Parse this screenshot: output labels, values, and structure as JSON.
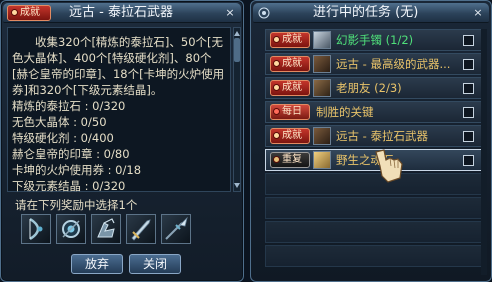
{
  "quest_detail": {
    "category_tag": "成就",
    "title": "远古 - 泰拉石武器",
    "close_glyph": "×",
    "description": "收集320个[精炼的泰拉石]、50个[无色大晶体]、400个[特级硬化剂]、80个[赫仑皇帝的印章]、18个[卡坤的火炉使用券]和320个[下级元素结晶]。",
    "requirements": [
      "精炼的泰拉石 : 0/320",
      "无色大晶体 : 0/50",
      "特级硬化剂 : 0/400",
      "赫仑皇帝的印章 : 0/80",
      "卡坤的火炉使用券 : 0/18",
      "下级元素结晶 : 0/320"
    ],
    "reward_prompt": "请在下列奖励中选择1个",
    "rewards": [
      {
        "icon": "bow-icon"
      },
      {
        "icon": "orb-staff-icon"
      },
      {
        "icon": "gauntlet-icon"
      },
      {
        "icon": "sword-icon"
      },
      {
        "icon": "spear-icon"
      }
    ],
    "abandon_label": "放弃",
    "close_label": "关闭"
  },
  "quest_list": {
    "title": "进行中的任务 (无)",
    "close_glyph": "×",
    "items": [
      {
        "tag": "成就",
        "tag_type": "achievement",
        "name": "幻影手镯 (1/2)",
        "color": "#4fe07a"
      },
      {
        "tag": "成就",
        "tag_type": "achievement",
        "name": "远古 - 最高级的武器...",
        "color": "#e8c36a"
      },
      {
        "tag": "成就",
        "tag_type": "achievement",
        "name": "老朋友 (2/3)",
        "color": "#e8c36a"
      },
      {
        "tag": "每日",
        "tag_type": "daily",
        "name": "制胜的关键",
        "color": "#e8c36a"
      },
      {
        "tag": "成就",
        "tag_type": "achievement",
        "name": "远古 - 泰拉石武器",
        "color": "#e8c36a"
      },
      {
        "tag": "重复",
        "tag_type": "repeat",
        "name": "野生之魂石",
        "color": "#e8c36a"
      }
    ]
  },
  "colors": {
    "accent_red": "#c4352b",
    "quest_gold": "#e8c36a",
    "quest_green": "#4fe07a",
    "text_body": "#e4ddc6"
  }
}
